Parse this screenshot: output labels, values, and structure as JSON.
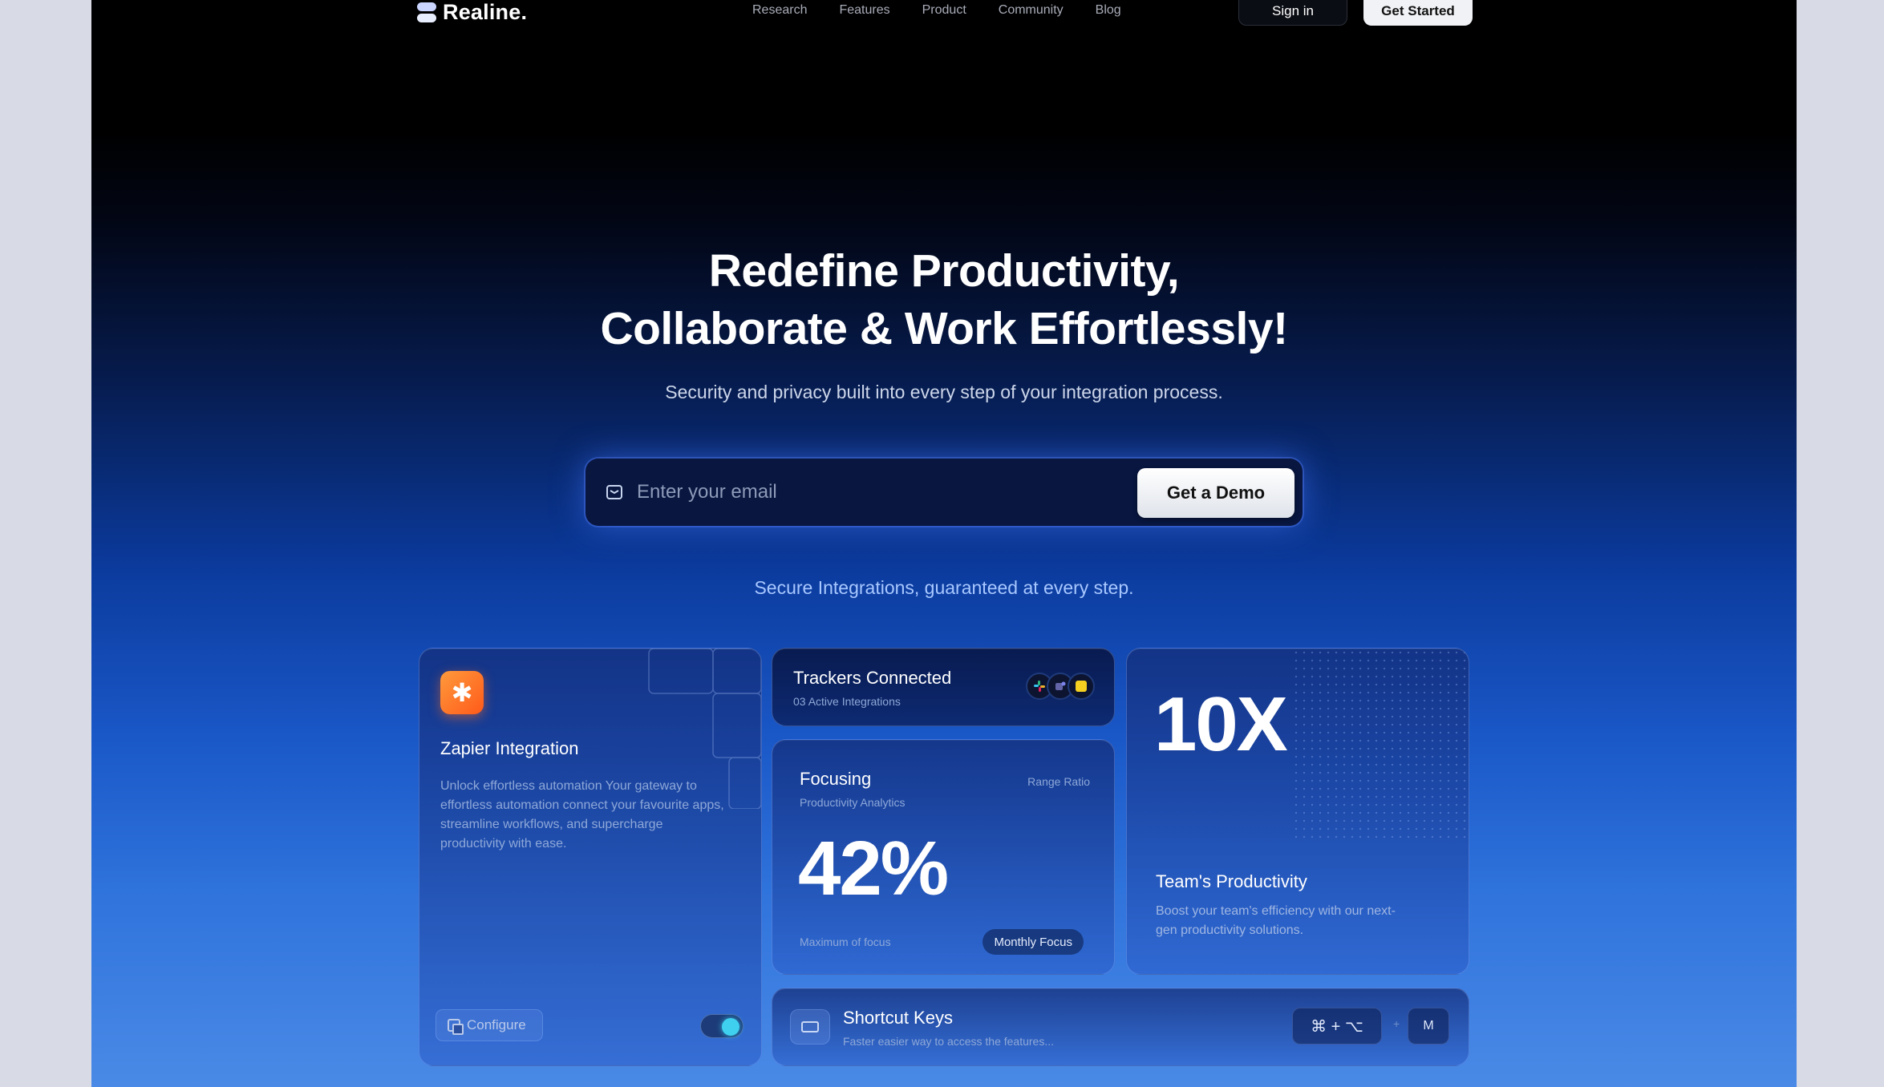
{
  "nav": {
    "brand": "Realine.",
    "links": [
      "Research",
      "Features",
      "Product",
      "Community",
      "Blog"
    ],
    "signin_label": "Sign in",
    "get_started_label": "Get Started"
  },
  "hero": {
    "title_line1": "Redefine Productivity,",
    "title_line2": "Collaborate & Work Effortlessly!",
    "subtitle": "Security and privacy built into every step of your integration process.",
    "email_placeholder": "Enter your email",
    "demo_label": "Get a Demo",
    "secure_text": "Secure Integrations, guaranteed at every step."
  },
  "cards": {
    "zapier": {
      "icon": "asterisk-icon",
      "title": "Zapier Integration",
      "description": "Unlock effortless automation Your gateway to effortless automation connect your favourite apps, streamline workflows, and supercharge productivity with ease.",
      "configure_label": "Configure",
      "toggle_on": true
    },
    "trackers": {
      "title": "Trackers Connected",
      "subtitle": "03 Active Integrations"
    },
    "focusing": {
      "title": "Focusing",
      "subtitle": "Productivity Analytics",
      "range_label": "Range Ratio",
      "value": "42%",
      "footer_label": "Maximum of focus",
      "pill_label": "Monthly Focus"
    },
    "productivity": {
      "value": "10X",
      "title": "Team's Productivity",
      "description": "Boost your team's efficiency with our next-gen productivity solutions."
    },
    "shortcut": {
      "title": "Shortcut Keys",
      "subtitle": "Faster easier way to access the features...",
      "combo": "⌘ + ⌥",
      "plus": "+",
      "key": "M"
    }
  },
  "colors": {
    "accent_orange": "#ff7a2a",
    "toggle_active": "#3fd0f0",
    "background_top": "#000000",
    "background_bottom": "#4a8ae6"
  }
}
